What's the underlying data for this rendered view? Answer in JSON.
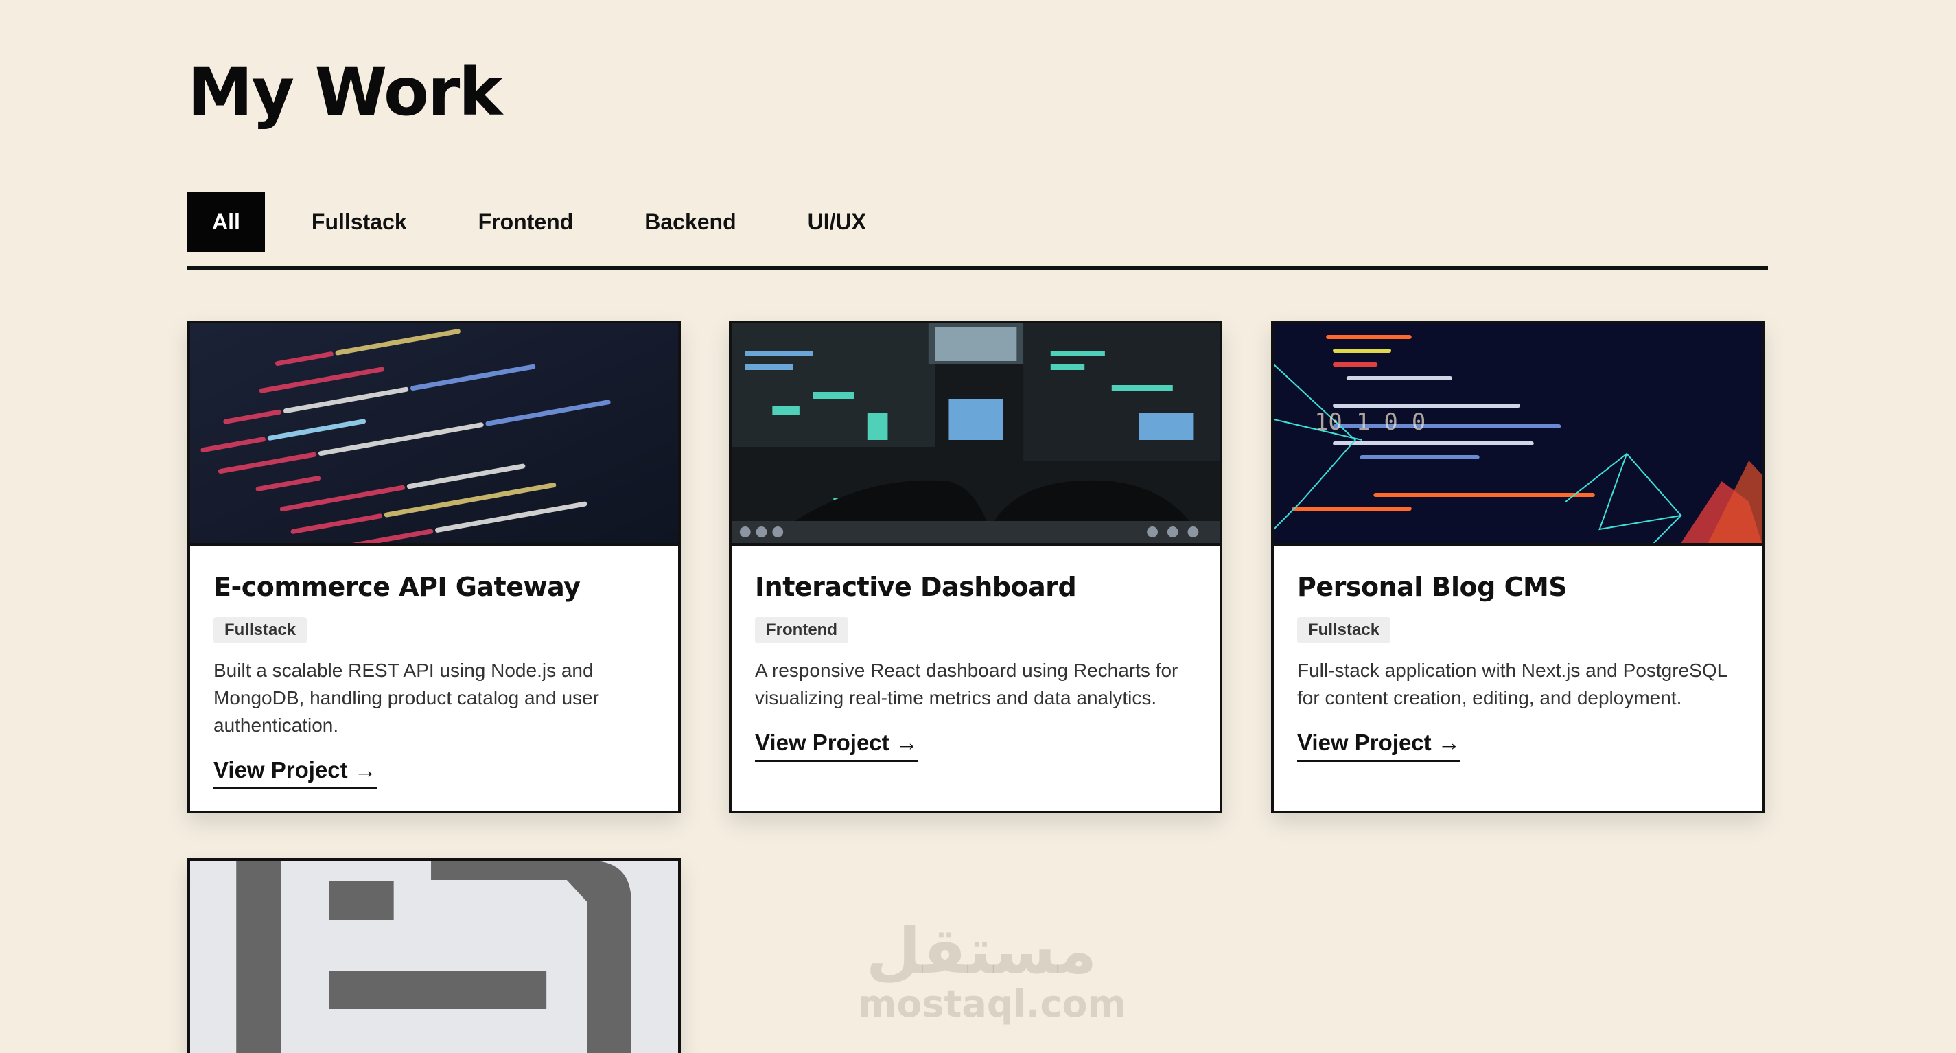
{
  "page": {
    "title": "My Work"
  },
  "tabs": [
    {
      "label": "All",
      "active": true
    },
    {
      "label": "Fullstack",
      "active": false
    },
    {
      "label": "Frontend",
      "active": false
    },
    {
      "label": "Backend",
      "active": false
    },
    {
      "label": "UI/UX",
      "active": false
    }
  ],
  "projects": [
    {
      "title": "E-commerce API Gateway",
      "tag": "Fullstack",
      "description": "Built a scalable REST API using Node.js and MongoDB, handling product catalog and user authentication.",
      "link": "View Project →",
      "image": "code-editor-screen"
    },
    {
      "title": "Interactive Dashboard",
      "tag": "Frontend",
      "description": "A responsive React dashboard using Recharts for visualizing real-time metrics and data analytics.",
      "link": "View Project →",
      "image": "monitors-dashboard"
    },
    {
      "title": "Personal Blog CMS",
      "tag": "Fullstack",
      "description": "Full-stack application with Next.js and PostgreSQL for content creation, editing, and deployment.",
      "link": "View Project →",
      "image": "data-network-art"
    },
    {
      "image": "placeholder-image-icon"
    }
  ],
  "watermark": {
    "arabic": "مستقل",
    "latin": "mostaql.com"
  }
}
